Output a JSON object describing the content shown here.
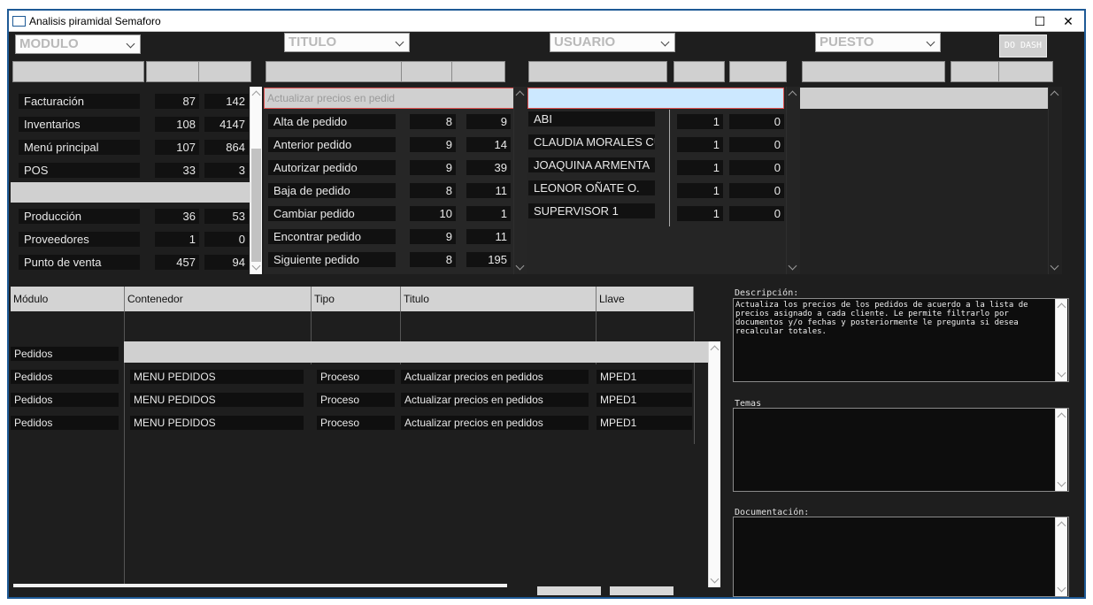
{
  "window": {
    "title": "Analisis piramidal  Semaforo",
    "minimize_label": "☐",
    "close_label": "✕"
  },
  "filters": {
    "modulo": "MODULO",
    "titulo": "TITULO",
    "usuario": "USUARIO",
    "puesto": "PUESTO",
    "do_dash": "DO DASH"
  },
  "modulos": [
    {
      "name": "Facturación",
      "a": "87",
      "b": "142"
    },
    {
      "name": "Inventarios",
      "a": "108",
      "b": "4147"
    },
    {
      "name": "Menú principal",
      "a": "107",
      "b": "864"
    },
    {
      "name": "POS",
      "a": "33",
      "b": "3"
    },
    {
      "name": "",
      "a": "",
      "b": ""
    },
    {
      "name": "Producción",
      "a": "36",
      "b": "53"
    },
    {
      "name": "Proveedores",
      "a": "1",
      "b": "0"
    },
    {
      "name": "Punto de venta",
      "a": "457",
      "b": "94"
    }
  ],
  "titulos": {
    "selected": "Actualizar precios en pedid",
    "rows": [
      {
        "name": "Alta de pedido",
        "a": "8",
        "b": "9"
      },
      {
        "name": "Anterior pedido",
        "a": "9",
        "b": "14"
      },
      {
        "name": "Autorizar pedido",
        "a": "9",
        "b": "39"
      },
      {
        "name": "Baja de pedido",
        "a": "8",
        "b": "11"
      },
      {
        "name": "Cambiar pedido",
        "a": "10",
        "b": "1"
      },
      {
        "name": "Encontrar pedido",
        "a": "9",
        "b": "11"
      },
      {
        "name": "Siguiente pedido",
        "a": "8",
        "b": "195"
      }
    ]
  },
  "usuarios": [
    {
      "name": "ABI",
      "a": "1",
      "b": "0"
    },
    {
      "name": "CLAUDIA MORALES CU",
      "a": "1",
      "b": "0"
    },
    {
      "name": "JOAQUINA ARMENTA",
      "a": "1",
      "b": "0"
    },
    {
      "name": "LEONOR OÑATE O.",
      "a": "1",
      "b": "0"
    },
    {
      "name": "SUPERVISOR 1",
      "a": "1",
      "b": "0"
    }
  ],
  "grid": {
    "headers": [
      "Módulo",
      "Contenedor",
      "Tipo",
      "Titulo",
      "Llave"
    ],
    "rows": [
      [
        "Pedidos",
        "",
        "",
        "",
        ""
      ],
      [
        "Pedidos",
        "MENU PEDIDOS",
        "Proceso",
        "Actualizar precios en pedidos",
        "MPED1"
      ],
      [
        "Pedidos",
        "MENU PEDIDOS",
        "Proceso",
        "Actualizar precios en pedidos",
        "MPED1"
      ],
      [
        "Pedidos",
        "MENU PEDIDOS",
        "Proceso",
        "Actualizar precios en pedidos",
        "MPED1"
      ]
    ]
  },
  "details": {
    "descripcion_label": "Descripción:",
    "descripcion": "Actualiza los precios de los pedidos de acuerdo a la lista de precios asignado a cada cliente. Le permite filtrarlo por documentos y/o fechas y posteriormente le pregunta si desea recalcular totales.",
    "temas_label": "Temas",
    "documentacion_label": "Documentación:"
  }
}
